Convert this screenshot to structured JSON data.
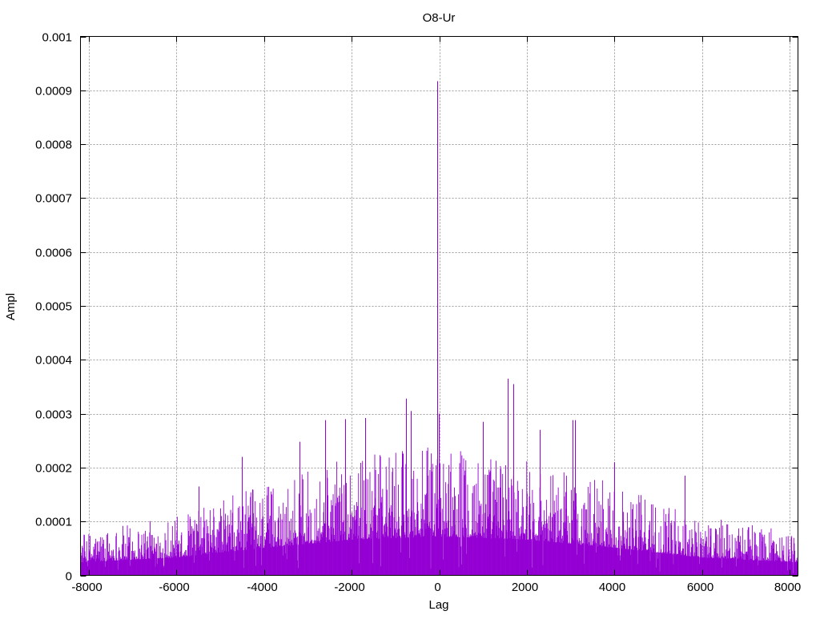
{
  "chart_data": {
    "type": "bar",
    "title": "O8-Ur",
    "xlabel": "Lag",
    "ylabel": "Ampl",
    "xlim": [
      -8192,
      8192
    ],
    "ylim": [
      0,
      0.001
    ],
    "xticks": [
      -8000,
      -6000,
      -4000,
      -2000,
      0,
      2000,
      4000,
      6000,
      8000
    ],
    "xtick_labels": [
      "-8000",
      "-6000",
      "-4000",
      "-2000",
      "0",
      "2000",
      "4000",
      "6000",
      "8000"
    ],
    "yticks": [
      0,
      0.0001,
      0.0002,
      0.0003,
      0.0004,
      0.0005,
      0.0006,
      0.0007,
      0.0008,
      0.0009,
      0.001
    ],
    "ytick_labels": [
      "0",
      "0.0001",
      "0.0002",
      "0.0003",
      "0.0004",
      "0.0005",
      "0.0006",
      "0.0007",
      "0.0008",
      "0.0009",
      "0.001"
    ],
    "grid": true,
    "series_color": "#9400d3",
    "grid_color": "#a0a0a0",
    "lag_step": 10,
    "envelope": [
      {
        "lag": -8192,
        "amp": 8e-05
      },
      {
        "lag": -6000,
        "amp": 0.00011
      },
      {
        "lag": -4000,
        "amp": 0.00017
      },
      {
        "lag": -2000,
        "amp": 0.00022
      },
      {
        "lag": 0,
        "amp": 0.00024
      },
      {
        "lag": 2000,
        "amp": 0.00022
      },
      {
        "lag": 4000,
        "amp": 0.00017
      },
      {
        "lag": 6000,
        "amp": 0.00011
      },
      {
        "lag": 8192,
        "amp": 8e-05
      }
    ],
    "peaks": [
      {
        "lag": -40,
        "amp": 0.000917
      },
      {
        "lag": -10,
        "amp": 0.0003
      },
      {
        "lag": 1570,
        "amp": 0.000365
      },
      {
        "lag": 1700,
        "amp": 0.000355
      },
      {
        "lag": -750,
        "amp": 0.000328
      },
      {
        "lag": -650,
        "amp": 0.000305
      },
      {
        "lag": -2600,
        "amp": 0.000288
      },
      {
        "lag": -2150,
        "amp": 0.00029
      },
      {
        "lag": -1700,
        "amp": 0.000292
      },
      {
        "lag": 3050,
        "amp": 0.000288
      },
      {
        "lag": 3100,
        "amp": 0.000288
      },
      {
        "lag": 1000,
        "amp": 0.000285
      },
      {
        "lag": 2300,
        "amp": 0.00027
      },
      {
        "lag": -3200,
        "amp": 0.000248
      },
      {
        "lag": -4500,
        "amp": 0.00022
      },
      {
        "lag": 4000,
        "amp": 0.00021
      },
      {
        "lag": 5600,
        "amp": 0.000185
      },
      {
        "lag": -5500,
        "amp": 0.000165
      }
    ]
  }
}
